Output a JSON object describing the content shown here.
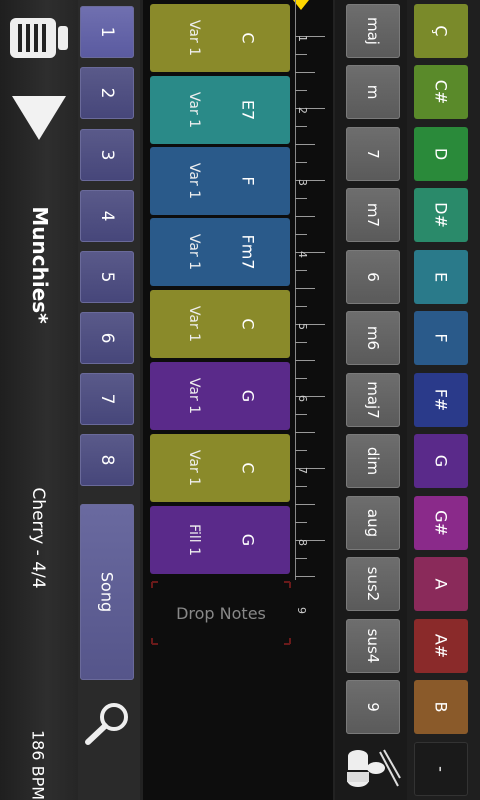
{
  "song": {
    "title": "Munchies*",
    "style": "Cherry - 4/4",
    "tempo": "186 BPM"
  },
  "numbers": [
    "1",
    "2",
    "3",
    "4",
    "5",
    "6",
    "7",
    "8"
  ],
  "song_button": "Song",
  "chords": [
    {
      "name": "C",
      "var": "Var 1",
      "color": "#8a8a2a"
    },
    {
      "name": "E7",
      "var": "Var 1",
      "color": "#2a8a88"
    },
    {
      "name": "F",
      "var": "Var 1",
      "color": "#2a5a8a"
    },
    {
      "name": "Fm7",
      "var": "Var 1",
      "color": "#2a5a8a"
    },
    {
      "name": "C",
      "var": "Var 1",
      "color": "#8a8a2a"
    },
    {
      "name": "G",
      "var": "Var 1",
      "color": "#5a2a8a"
    },
    {
      "name": "C",
      "var": "Var 1",
      "color": "#8a8a2a"
    },
    {
      "name": "G",
      "var": "Fill 1",
      "color": "#5a2a8a"
    }
  ],
  "drop_notes": "Drop Notes",
  "ruler_numbers": [
    "1",
    "2",
    "3",
    "4",
    "5",
    "6",
    "7",
    "8",
    "9"
  ],
  "qualities": [
    "maj",
    "m",
    "7",
    "m7",
    "6",
    "m6",
    "maj7",
    "dim",
    "aug",
    "sus2",
    "sus4",
    "9"
  ],
  "notes": [
    {
      "label": "Ç",
      "color": "#7a8a2a"
    },
    {
      "label": "C#",
      "color": "#5a8a2a"
    },
    {
      "label": "D",
      "color": "#2a8a3a"
    },
    {
      "label": "D#",
      "color": "#2a8a6a"
    },
    {
      "label": "E",
      "color": "#2a7a8a"
    },
    {
      "label": "F",
      "color": "#2a5a8a"
    },
    {
      "label": "F#",
      "color": "#2a3a8a"
    },
    {
      "label": "G",
      "color": "#5a2a8a"
    },
    {
      "label": "G#",
      "color": "#8a2a8a"
    },
    {
      "label": "A",
      "color": "#8a2a5a"
    },
    {
      "label": "A#",
      "color": "#8a2a2a"
    },
    {
      "label": "B",
      "color": "#8a5a2a"
    },
    {
      "label": "-",
      "color": "#1a1a1a"
    }
  ]
}
